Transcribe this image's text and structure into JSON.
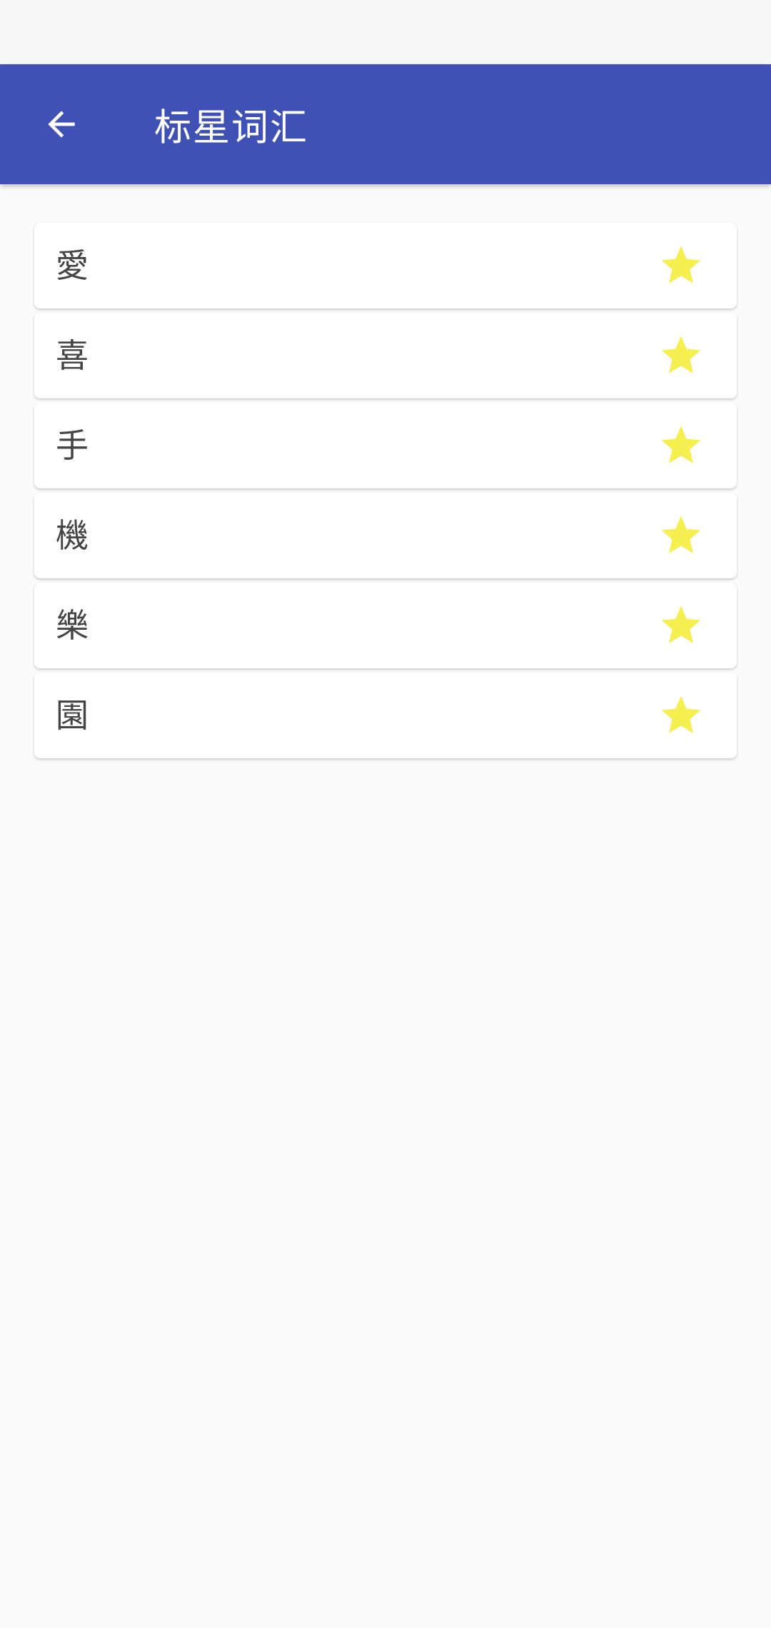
{
  "app_bar": {
    "title": "标星词汇",
    "color": "#3f51b5",
    "back_icon": "arrow-left-icon"
  },
  "starred_words": [
    {
      "word": "愛"
    },
    {
      "word": "喜"
    },
    {
      "word": "手"
    },
    {
      "word": "機"
    },
    {
      "word": "樂"
    },
    {
      "word": "園"
    }
  ],
  "star_icon": "star-icon",
  "star_color": "#f5ef4f"
}
